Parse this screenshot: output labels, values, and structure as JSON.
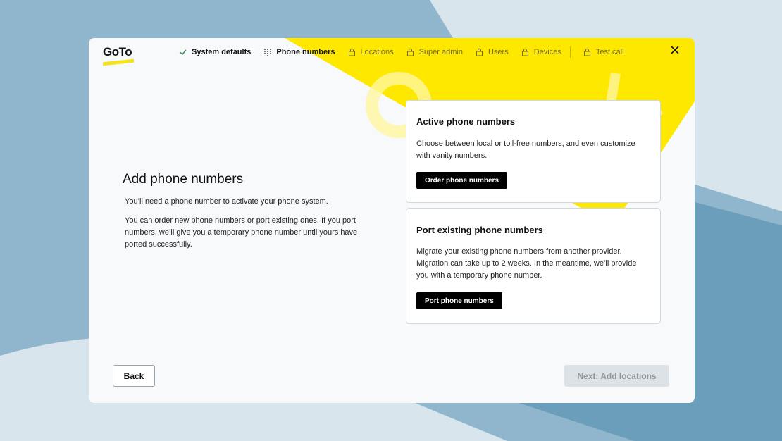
{
  "colors": {
    "accent": "#ffe800",
    "done": "#2e8b57",
    "disabled_bg": "#dde2e6"
  },
  "logo": {
    "text": "GoTo"
  },
  "steps": [
    {
      "label": "System defaults",
      "state": "done",
      "icon": "check-icon"
    },
    {
      "label": "Phone numbers",
      "state": "current",
      "icon": "keypad-icon"
    },
    {
      "label": "Locations",
      "state": "locked",
      "icon": "lock-icon"
    },
    {
      "label": "Super admin",
      "state": "locked",
      "icon": "lock-icon"
    },
    {
      "label": "Users",
      "state": "locked",
      "icon": "lock-icon"
    },
    {
      "label": "Devices",
      "state": "locked",
      "icon": "lock-icon"
    },
    {
      "label": "Test call",
      "state": "locked",
      "icon": "lock-icon"
    }
  ],
  "main": {
    "title": "Add phone numbers",
    "para1": "You’ll need a phone number to activate your phone system.",
    "para2": "You can order new phone numbers or port existing ones. If you port numbers, we’ll give you a temporary phone number until yours have ported successfully."
  },
  "cards": {
    "active": {
      "title": "Active phone numbers",
      "body": "Choose between local or toll-free numbers, and even customize with vanity numbers.",
      "button": "Order phone numbers"
    },
    "port": {
      "title": "Port existing phone numbers",
      "body": "Migrate your existing phone numbers from another provider. Migration can take up to 2 weeks. In the meantime, we’ll provide you with a temporary phone number.",
      "button": "Port phone numbers"
    }
  },
  "footer": {
    "back": "Back",
    "next": "Next: Add locations"
  }
}
